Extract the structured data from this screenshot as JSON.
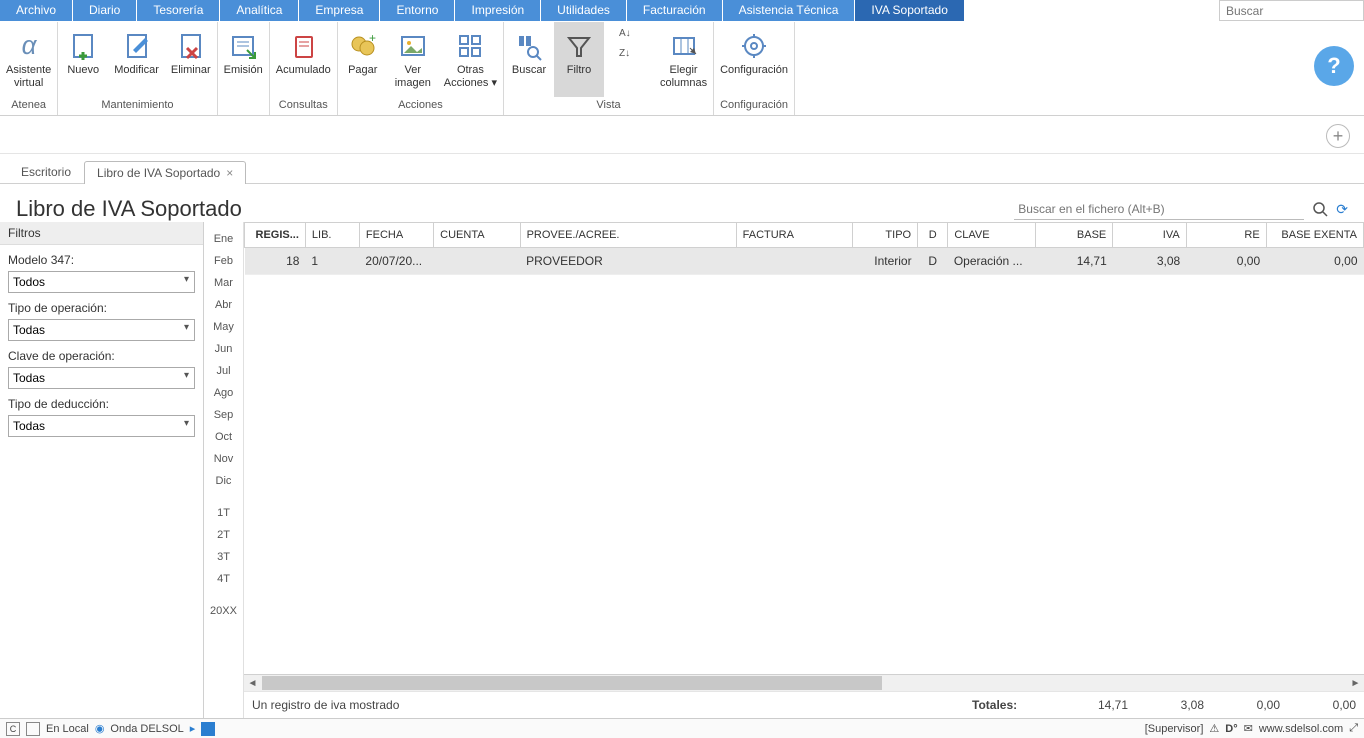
{
  "menu": [
    "Archivo",
    "Diario",
    "Tesorería",
    "Analítica",
    "Empresa",
    "Entorno",
    "Impresión",
    "Utilidades",
    "Facturación",
    "Asistencia Técnica",
    "IVA Soportado"
  ],
  "menu_active_index": 10,
  "global_search_placeholder": "Buscar",
  "ribbon": {
    "groups": [
      {
        "title": "Atenea",
        "buttons": [
          {
            "label": "Asistente\nvirtual",
            "icon": "alpha"
          }
        ]
      },
      {
        "title": "Mantenimiento",
        "buttons": [
          {
            "label": "Nuevo",
            "icon": "new"
          },
          {
            "label": "Modificar",
            "icon": "edit"
          },
          {
            "label": "Eliminar",
            "icon": "delete"
          }
        ]
      },
      {
        "title": "",
        "buttons": [
          {
            "label": "Emisión",
            "icon": "emit"
          }
        ]
      },
      {
        "title": "Consultas",
        "buttons": [
          {
            "label": "Acumulado",
            "icon": "book"
          }
        ]
      },
      {
        "title": "Acciones",
        "buttons": [
          {
            "label": "Pagar",
            "icon": "pay"
          },
          {
            "label": "Ver\nimagen",
            "icon": "image"
          },
          {
            "label": "Otras\nAcciones ▾",
            "icon": "other"
          }
        ]
      },
      {
        "title": "Vista",
        "buttons": [
          {
            "label": "Buscar",
            "icon": "search"
          },
          {
            "label": "Filtro",
            "icon": "filter",
            "active": true
          },
          {
            "label": "",
            "icon": "sort"
          },
          {
            "label": "Elegir\ncolumnas",
            "icon": "columns"
          }
        ]
      },
      {
        "title": "Configuración",
        "buttons": [
          {
            "label": "Configuración",
            "icon": "gear"
          }
        ]
      }
    ]
  },
  "tabs": [
    {
      "label": "Escritorio",
      "active": false,
      "closable": false
    },
    {
      "label": "Libro de IVA Soportado",
      "active": true,
      "closable": true
    }
  ],
  "page_title": "Libro de IVA Soportado",
  "file_search_placeholder": "Buscar en el fichero (Alt+B)",
  "filters": {
    "panel_title": "Filtros",
    "items": [
      {
        "label": "Modelo 347:",
        "value": "Todos"
      },
      {
        "label": "Tipo de operación:",
        "value": "Todas"
      },
      {
        "label": "Clave de operación:",
        "value": "Todas"
      },
      {
        "label": "Tipo de deducción:",
        "value": "Todas"
      }
    ]
  },
  "months": [
    "Ene",
    "Feb",
    "Mar",
    "Abr",
    "May",
    "Jun",
    "Jul",
    "Ago",
    "Sep",
    "Oct",
    "Nov",
    "Dic",
    "",
    "1T",
    "2T",
    "3T",
    "4T",
    "",
    "20XX"
  ],
  "table": {
    "columns": [
      "REGIS...",
      "LIB.",
      "FECHA",
      "CUENTA",
      "PROVEE./ACREE.",
      "FACTURA",
      "TIPO",
      "D",
      "CLAVE",
      "BASE",
      "IVA",
      "RE",
      "BASE EXENTA"
    ],
    "col_align": [
      "right",
      "left",
      "left",
      "left",
      "left",
      "left",
      "right",
      "center",
      "left",
      "right",
      "right",
      "right",
      "right"
    ],
    "rows": [
      {
        "cells": [
          "18",
          "1",
          "20/07/20...",
          "",
          "PROVEEDOR",
          "",
          "Interior",
          "D",
          "Operación ...",
          "14,71",
          "3,08",
          "0,00",
          "0,00"
        ]
      }
    ],
    "status_text": "Un registro de iva mostrado",
    "totals_label": "Totales:",
    "totals": [
      "14,71",
      "3,08",
      "0,00",
      "0,00"
    ]
  },
  "statusbar": {
    "left_c": "C",
    "en_local": "En Local",
    "onda": "Onda DELSOL",
    "supervisor": "[Supervisor]",
    "url": "www.sdelsol.com"
  }
}
